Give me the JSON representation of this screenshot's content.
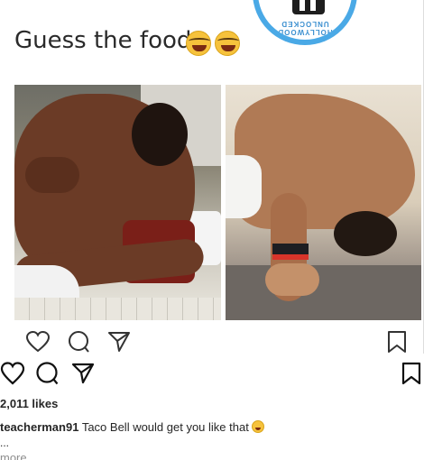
{
  "post": {
    "meme_caption": "Guess the food",
    "meme_emojis": [
      "joy-emoji",
      "joy-emoji"
    ],
    "logo_text": "HOLLYWOOD UNLOCKED",
    "image_actions": [
      "heart-icon",
      "comment-icon",
      "share-icon",
      "bookmark-icon"
    ]
  },
  "actions": {
    "icons": [
      "heart-icon",
      "comment-icon",
      "share-icon",
      "bookmark-icon"
    ]
  },
  "likes": {
    "text": "2,011 likes"
  },
  "caption": {
    "username": "teacherman91",
    "text": " Taco Bell would get you like that",
    "emoji": "joy-emoji",
    "ellipsis": "...",
    "more": "more"
  },
  "colors": {
    "logo_ring": "#4aa9e6",
    "text_primary": "#262626",
    "text_secondary": "#8e8e8e"
  }
}
